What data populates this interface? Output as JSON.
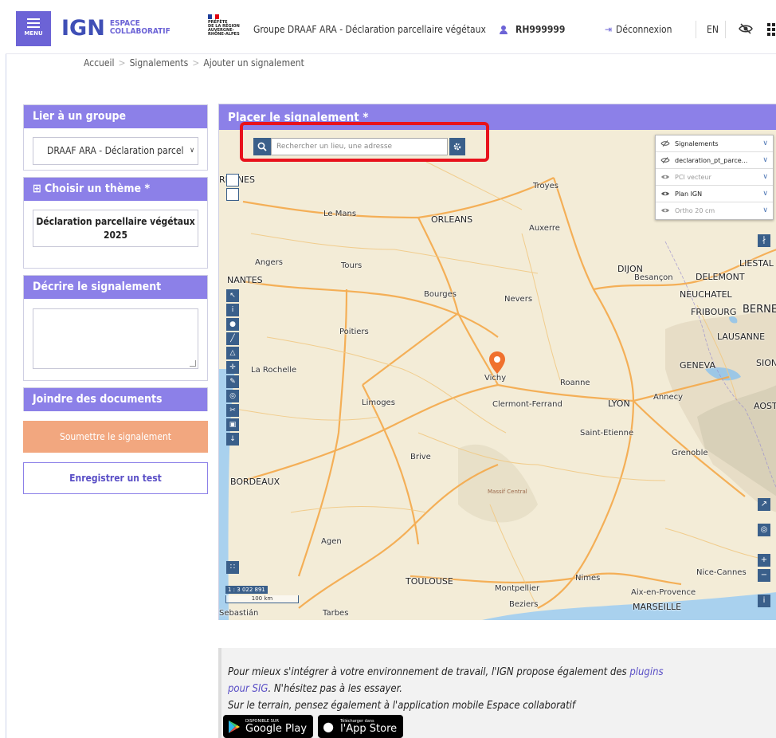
{
  "header": {
    "menu_label": "MENU",
    "logo_ign": "IGN",
    "logo_line1": "ESPACE",
    "logo_line2": "COLLABORATIF",
    "prefecture_lines": [
      "PRÉFÈTE",
      "DE LA RÉGION",
      "AUVERGNE-",
      "RHÔNE-ALPES"
    ],
    "group_title": "Groupe DRAAF ARA - Déclaration parcellaire végétaux",
    "user": "RH999999",
    "logout": "Déconnexion",
    "lang": "EN"
  },
  "breadcrumb": [
    "Accueil",
    "Signalements",
    "Ajouter un signalement"
  ],
  "sidebar": {
    "group_title": "Lier à un groupe",
    "group_value": "DRAAF ARA - Déclaration parcel",
    "theme_title": "Choisir un thème",
    "theme_required": "*",
    "theme_value_line1": "Déclaration parcellaire végétaux",
    "theme_value_line2": "2025",
    "describe_title": "Décrire le signalement",
    "describe_value": "",
    "docs_title": "Joindre des documents",
    "submit_label": "Soumettre le signalement",
    "test_label": "Enregistrer un test"
  },
  "map": {
    "title": "Placer le signalement",
    "required": "*",
    "search_placeholder": "Rechercher un lieu, une adresse",
    "layers": [
      {
        "name": "Signalements",
        "dim": false
      },
      {
        "name": "declaration_pt_parce...",
        "dim": false
      },
      {
        "name": "PCI vecteur",
        "dim": true
      },
      {
        "name": "Plan IGN",
        "dim": false
      },
      {
        "name": "Ortho 20 cm",
        "dim": true
      }
    ],
    "scale_zoom": "1 : 3 022 891",
    "scale_distance": "100 km",
    "places": [
      {
        "name": "RENNES",
        "big": true
      },
      {
        "name": "Le Mans",
        "big": false
      },
      {
        "name": "ORLEANS",
        "big": true
      },
      {
        "name": "Troyes",
        "big": false
      },
      {
        "name": "Auxerre",
        "big": false
      },
      {
        "name": "Angers",
        "big": false
      },
      {
        "name": "Tours",
        "big": false
      },
      {
        "name": "NANTES",
        "big": true
      },
      {
        "name": "Bourges",
        "big": false
      },
      {
        "name": "Nevers",
        "big": false
      },
      {
        "name": "DIJON",
        "big": true
      },
      {
        "name": "Besançon",
        "big": false
      },
      {
        "name": "DELEMONT",
        "big": true
      },
      {
        "name": "LIESTAL",
        "big": true
      },
      {
        "name": "NEUCHATEL",
        "big": true
      },
      {
        "name": "FRIBOURG",
        "big": true
      },
      {
        "name": "BERNE",
        "big": true
      },
      {
        "name": "Poitiers",
        "big": false
      },
      {
        "name": "LAUSANNE",
        "big": true
      },
      {
        "name": "La Rochelle",
        "big": false
      },
      {
        "name": "GENEVA",
        "big": true
      },
      {
        "name": "SION",
        "big": true
      },
      {
        "name": "Vichy",
        "big": false
      },
      {
        "name": "Roanne",
        "big": false
      },
      {
        "name": "Limoges",
        "big": false
      },
      {
        "name": "Clermont-Ferrand",
        "big": false
      },
      {
        "name": "LYON",
        "big": true
      },
      {
        "name": "Annecy",
        "big": false
      },
      {
        "name": "AOST",
        "big": true
      },
      {
        "name": "Saint-Etienne",
        "big": false
      },
      {
        "name": "Brive",
        "big": false
      },
      {
        "name": "Grenoble",
        "big": false
      },
      {
        "name": "BORDEAUX",
        "big": true
      },
      {
        "name": "Massif Central",
        "big": false
      },
      {
        "name": "Agen",
        "big": false
      },
      {
        "name": "Nimes",
        "big": false
      },
      {
        "name": "TOULOUSE",
        "big": true
      },
      {
        "name": "Montpellier",
        "big": false
      },
      {
        "name": "Nice-Cannes",
        "big": false
      },
      {
        "name": "Aix-en-Provence",
        "big": false
      },
      {
        "name": "Beziers",
        "big": false
      },
      {
        "name": "MARSEILLE",
        "big": true
      },
      {
        "name": "Tarbes",
        "big": false
      },
      {
        "name": "Sebastián",
        "big": false
      }
    ]
  },
  "promo": {
    "line1_a": "Pour mieux s'intégrer à votre environnement de travail, l'IGN propose également des ",
    "line1_link": "plugins",
    "line2_link": "pour SIG",
    "line2_b": ". N'hésitez pas à les essayer.",
    "line3": "Sur le terrain, pensez également à l'application mobile Espace collaboratif",
    "google_small": "DISPONIBLE SUR",
    "google_big": "Google Play",
    "apple_small": "Télécharger dans",
    "apple_big": "l'App Store"
  },
  "colors": {
    "accent": "#8c80e8",
    "submit": "#f2a77f",
    "highlight": "#e8121c"
  }
}
